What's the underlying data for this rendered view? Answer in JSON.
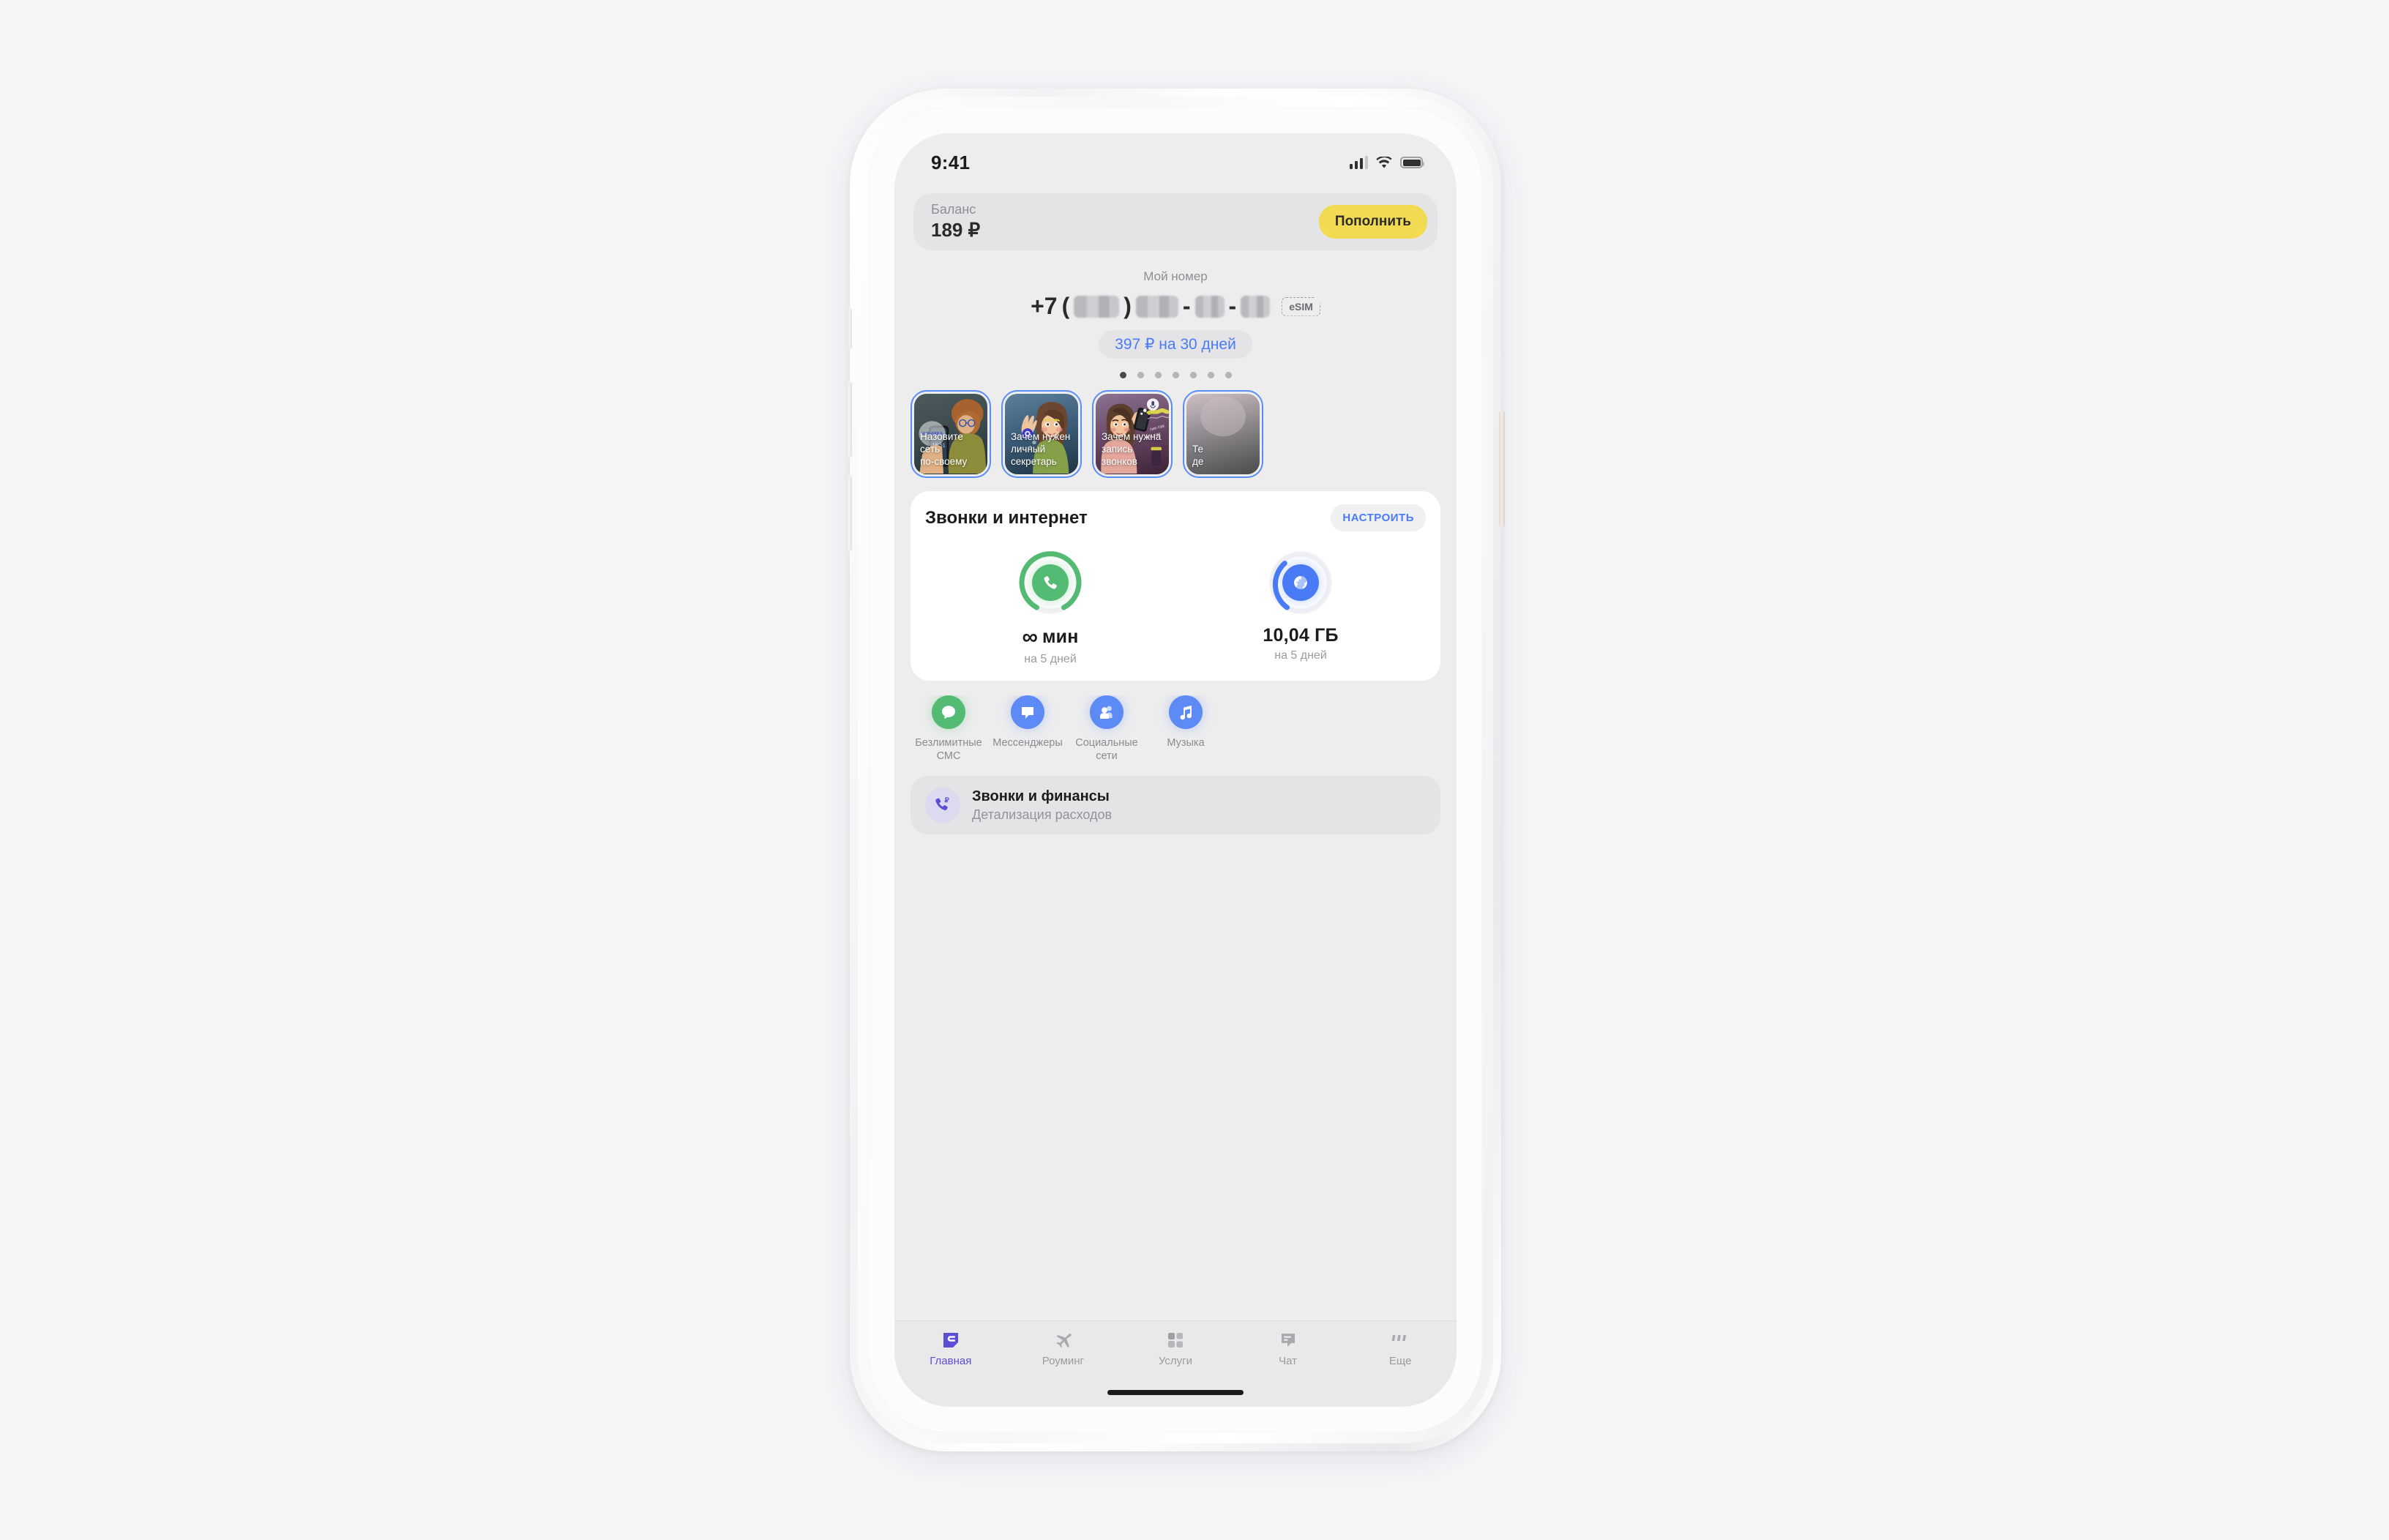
{
  "status_bar": {
    "time": "9:41",
    "signal_icon": "cellular-signal-icon",
    "wifi_icon": "wifi-icon",
    "battery_icon": "battery-icon"
  },
  "balance": {
    "label": "Баланс",
    "value": "189 ₽",
    "topup_label": "Пополнить",
    "topup_color": "#f2da53"
  },
  "my_number": {
    "label": "Мой номер",
    "prefix": "+7",
    "redacted": true,
    "esim_badge": "eSIM",
    "tariff": "397 ₽ на 30 дней",
    "tariff_color": "#4a7bf7",
    "dots_total": 7,
    "dots_active_index": 0
  },
  "stories": [
    {
      "title": "Назовите\nсеть\nпо-своему"
    },
    {
      "title": "Зачем нужен\nличный\nсекретарь"
    },
    {
      "title": "Зачем нужна\nзапись\nзвонков"
    },
    {
      "title": "Те\nде"
    }
  ],
  "calls_internet": {
    "title": "Звонки и интернет",
    "setup_label": "НАСТРОИТЬ",
    "gauges": [
      {
        "icon": "phone-icon",
        "value": "∞",
        "unit": "мин",
        "sub": "на 5 дней",
        "color": "#54bb74",
        "percent": 100
      },
      {
        "icon": "globe-icon",
        "value": "10,04 ГБ",
        "unit": "",
        "sub": "на 5 дней",
        "color": "#4a7bf7",
        "percent": 34
      }
    ]
  },
  "services": [
    {
      "label": "Безлимитные\nСМС",
      "icon": "chat-bubble-icon",
      "color": "#54bb74"
    },
    {
      "label": "Мессенджеры",
      "icon": "message-square-icon",
      "color": "#5d8af5"
    },
    {
      "label": "Социальные\nсети",
      "icon": "people-icon",
      "color": "#5d8af5"
    },
    {
      "label": "Музыка",
      "icon": "music-note-icon",
      "color": "#5d8af5"
    }
  ],
  "finance_row": {
    "icon": "phone-ruble-icon",
    "title": "Звонки и финансы",
    "subtitle": "Детализация расходов"
  },
  "tabs": [
    {
      "label": "Главная",
      "icon": "home-logo-icon",
      "active": true
    },
    {
      "label": "Роуминг",
      "icon": "airplane-icon",
      "active": false
    },
    {
      "label": "Услуги",
      "icon": "grid-icon",
      "active": false
    },
    {
      "label": "Чат",
      "icon": "chat-icon",
      "active": false
    },
    {
      "label": "Еще",
      "icon": "more-icon",
      "active": false
    }
  ]
}
